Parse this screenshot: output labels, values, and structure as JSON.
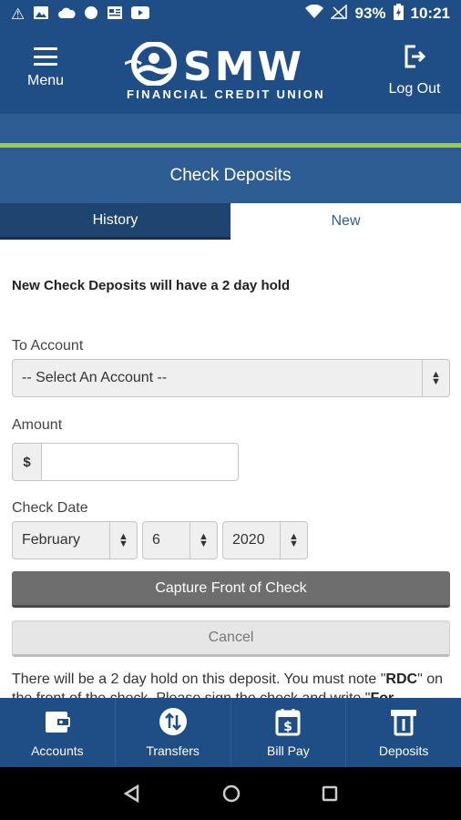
{
  "status_bar": {
    "battery": "93%",
    "time": "10:21"
  },
  "header": {
    "menu_label": "Menu",
    "logo_name": "SMW",
    "logo_subtitle": "FINANCIAL CREDIT UNION",
    "logout_label": "Log Out"
  },
  "page": {
    "title": "Check Deposits"
  },
  "tabs": {
    "history": "History",
    "new": "New"
  },
  "form": {
    "hold_notice": "New Check Deposits will have a 2 day hold",
    "to_account_label": "To Account",
    "to_account_value": "-- Select An Account --",
    "amount_label": "Amount",
    "amount_addon": "$",
    "amount_value": "",
    "check_date_label": "Check Date",
    "month": "February",
    "day": "6",
    "year": "2020",
    "capture_button": "Capture Front of Check",
    "cancel_button": "Cancel",
    "disclaimer_part1": "There will be a 2 day hold on this deposit. You must note \"",
    "disclaimer_bold1": "RDC",
    "disclaimer_part2": "\" on the front of the check. Please sign the check and write \"",
    "disclaimer_bold2": "For"
  },
  "bottom_nav": {
    "accounts": "Accounts",
    "transfers": "Transfers",
    "bill_pay": "Bill Pay",
    "deposits": "Deposits"
  },
  "colors": {
    "primary": "#1f4e86",
    "secondary": "#2d5d93",
    "accent": "#9ecb44",
    "capture_button": "#6e6e6e"
  }
}
